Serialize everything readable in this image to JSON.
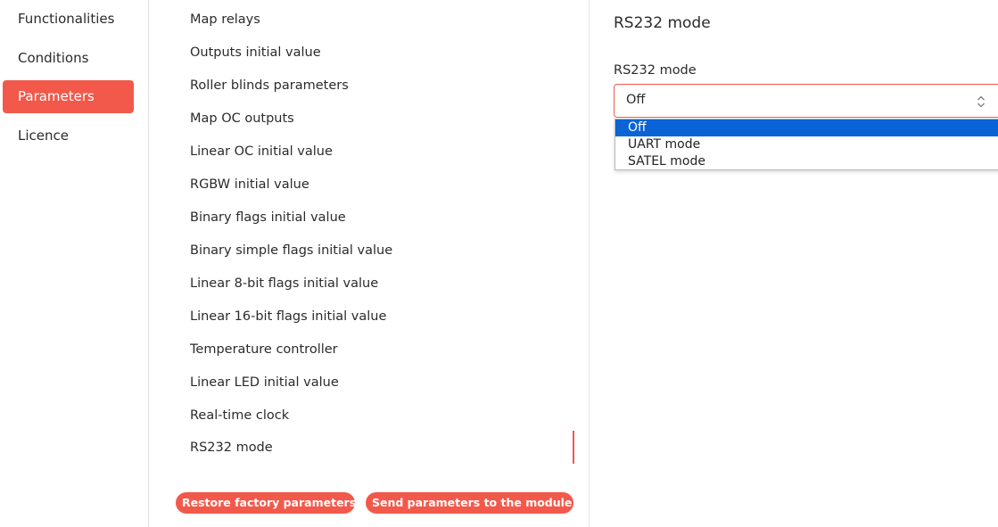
{
  "sidebar": {
    "items": [
      {
        "label": "Functionalities",
        "active": false
      },
      {
        "label": "Conditions",
        "active": false
      },
      {
        "label": "Parameters",
        "active": true
      },
      {
        "label": "Licence",
        "active": false
      }
    ]
  },
  "params": {
    "items": [
      "Map relays",
      "Outputs initial value",
      "Roller blinds parameters",
      "Map OC outputs",
      "Linear OC initial value",
      "RGBW initial value",
      "Binary flags initial value",
      "Binary simple flags initial value",
      "Linear 8-bit flags initial value",
      "Linear 16-bit flags initial value",
      "Temperature controller",
      "Linear LED initial value",
      "Real-time clock",
      "RS232 mode"
    ],
    "active_item": "RS232 mode",
    "restore_label": "Restore factory parameters",
    "send_label": "Send parameters to the module"
  },
  "panel": {
    "title": "RS232 mode",
    "field_label": "RS232 mode",
    "select_value": "Off",
    "options": [
      "Off",
      "UART mode",
      "SATEL mode"
    ]
  },
  "colors": {
    "accent": "#f2594b",
    "selection": "#0a64d6"
  }
}
